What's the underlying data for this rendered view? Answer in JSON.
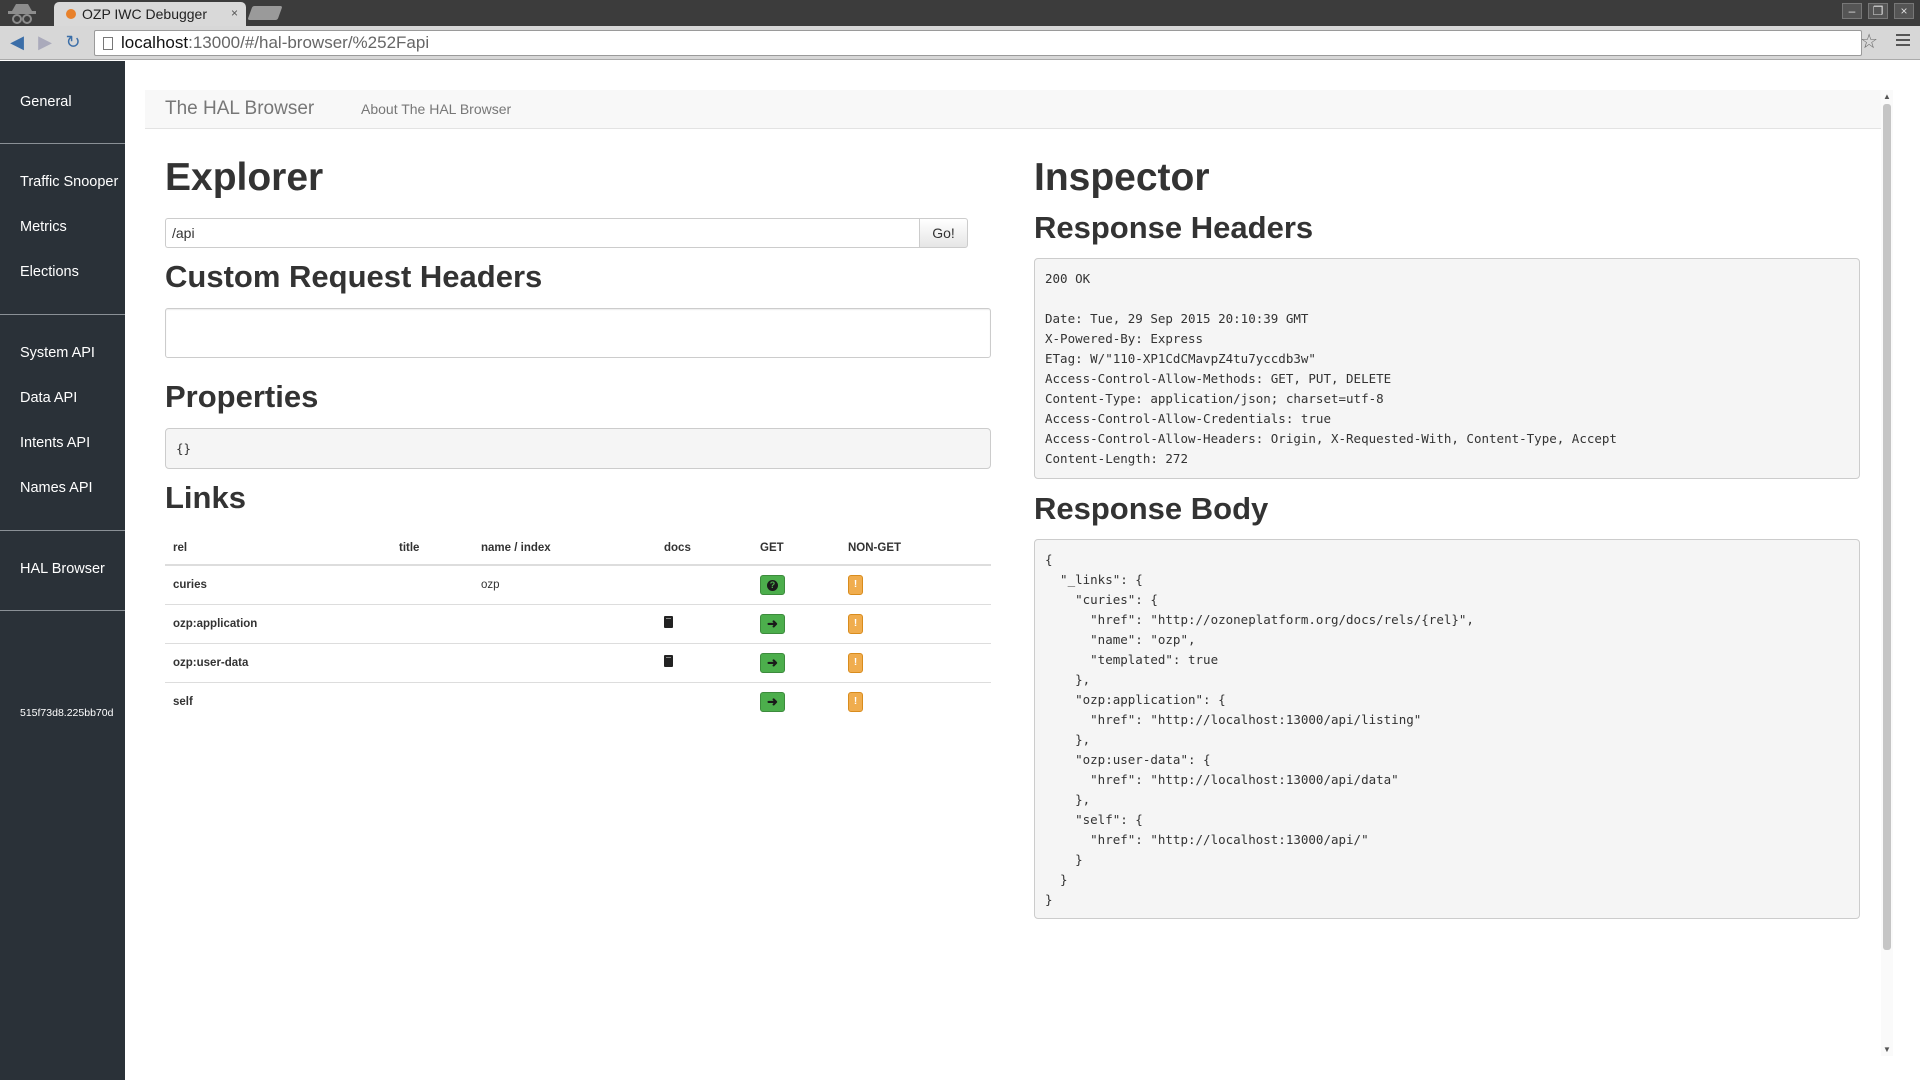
{
  "browser": {
    "tab_title": "OZP IWC Debugger",
    "tab_close": "×",
    "url_host": "localhost",
    "url_rest": ":13000/#/hal-browser/%252Fapi"
  },
  "sidebar": {
    "items": [
      {
        "label": "General"
      },
      {
        "label": "Traffic Snooper"
      },
      {
        "label": "Metrics"
      },
      {
        "label": "Elections"
      },
      {
        "label": "System API"
      },
      {
        "label": "Data API"
      },
      {
        "label": "Intents API"
      },
      {
        "label": "Names API"
      },
      {
        "label": "HAL Browser"
      }
    ],
    "client_id": "515f73d8.225bb70d"
  },
  "hal_nav": {
    "brand": "The HAL Browser",
    "about_link": "About The HAL Browser"
  },
  "explorer": {
    "title": "Explorer",
    "uri_value": "/api",
    "go_label": "Go!",
    "custom_headers_title": "Custom Request Headers",
    "custom_headers_value": "",
    "properties_title": "Properties",
    "properties_value": "{}",
    "links_title": "Links",
    "links_columns": [
      "rel",
      "title",
      "name / index",
      "docs",
      "GET",
      "NON-GET"
    ],
    "links_rows": [
      {
        "rel": "curies",
        "title": "",
        "name": "ozp",
        "docs": false,
        "get_icon": "question-icon"
      },
      {
        "rel": "ozp:application",
        "title": "",
        "name": "",
        "docs": true,
        "get_icon": "arrow-right-icon"
      },
      {
        "rel": "ozp:user-data",
        "title": "",
        "name": "",
        "docs": true,
        "get_icon": "arrow-right-icon"
      },
      {
        "rel": "self",
        "title": "",
        "name": "",
        "docs": false,
        "get_icon": "arrow-right-icon"
      }
    ],
    "nonget_symbol": "!",
    "get_arrow": "➜",
    "get_question": "?"
  },
  "inspector": {
    "title": "Inspector",
    "response_headers_title": "Response Headers",
    "response_headers": "200 OK\n\nDate: Tue, 29 Sep 2015 20:10:39 GMT\nX-Powered-By: Express\nETag: W/\"110-XP1CdCMavpZ4tu7yccdb3w\"\nAccess-Control-Allow-Methods: GET, PUT, DELETE\nContent-Type: application/json; charset=utf-8\nAccess-Control-Allow-Credentials: true\nAccess-Control-Allow-Headers: Origin, X-Requested-With, Content-Type, Accept\nContent-Length: 272",
    "response_body_title": "Response Body",
    "response_body": "{\n  \"_links\": {\n    \"curies\": {\n      \"href\": \"http://ozoneplatform.org/docs/rels/{rel}\",\n      \"name\": \"ozp\",\n      \"templated\": true\n    },\n    \"ozp:application\": {\n      \"href\": \"http://localhost:13000/api/listing\"\n    },\n    \"ozp:user-data\": {\n      \"href\": \"http://localhost:13000/api/data\"\n    },\n    \"self\": {\n      \"href\": \"http://localhost:13000/api/\"\n    }\n  }\n}"
  },
  "colors": {
    "sidebar_bg": "#2a3138",
    "get_button": "#4cae4c",
    "nonget_button": "#f0ad4e"
  }
}
